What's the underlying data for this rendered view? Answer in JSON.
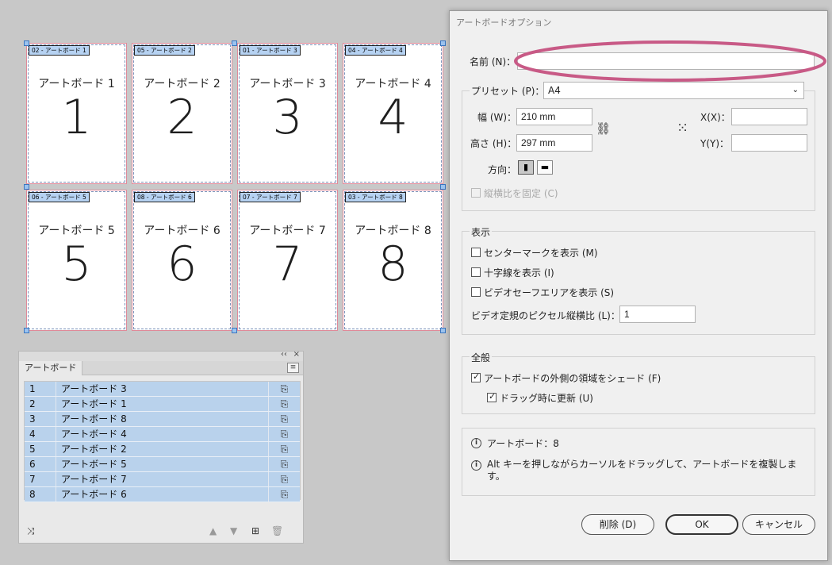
{
  "artboards": [
    {
      "tag": "02 - アートボード 1",
      "name": "アートボード 1",
      "num": "1"
    },
    {
      "tag": "05 - アートボード 2",
      "name": "アートボード 2",
      "num": "2"
    },
    {
      "tag": "01 - アートボード 3",
      "name": "アートボード 3",
      "num": "3"
    },
    {
      "tag": "04 - アートボード 4",
      "name": "アートボード 4",
      "num": "4"
    },
    {
      "tag": "06 - アートボード 5",
      "name": "アートボード 5",
      "num": "5"
    },
    {
      "tag": "08 - アートボード 6",
      "name": "アートボード 6",
      "num": "6"
    },
    {
      "tag": "07 - アートボード 7",
      "name": "アートボード 7",
      "num": "7"
    },
    {
      "tag": "03 - アートボード 8",
      "name": "アートボード 8",
      "num": "8"
    }
  ],
  "panel": {
    "tab": "アートボード",
    "rows": [
      {
        "n": "1",
        "label": "アートボード 3"
      },
      {
        "n": "2",
        "label": "アートボード 1"
      },
      {
        "n": "3",
        "label": "アートボード 8"
      },
      {
        "n": "4",
        "label": "アートボード 4"
      },
      {
        "n": "5",
        "label": "アートボード 2"
      },
      {
        "n": "6",
        "label": "アートボード 5"
      },
      {
        "n": "7",
        "label": "アートボード 7"
      },
      {
        "n": "8",
        "label": "アートボード 6"
      }
    ]
  },
  "dialog": {
    "title": "アートボードオプション",
    "name_label": "名前 (N)：",
    "name_value": "",
    "preset_label": "プリセット (P)：",
    "preset_value": "A4",
    "width_label": "幅 (W)：",
    "width_value": "210 mm",
    "height_label": "高さ (H)：",
    "height_value": "297 mm",
    "x_label": "X(X)：",
    "x_value": "",
    "y_label": "Y(Y)：",
    "y_value": "",
    "orientation_label": "方向：",
    "lock_ratio_label": "縦横比を固定 (C)",
    "display_title": "表示",
    "center_mark_label": "センターマークを表示 (M)",
    "crosshair_label": "十字線を表示 (I)",
    "video_safe_label": "ビデオセーフエリアを表示 (S)",
    "pixel_ratio_label": "ビデオ定規のピクセル縦横比 (L)：",
    "pixel_ratio_value": "1",
    "general_title": "全般",
    "shade_label": "アートボードの外側の領域をシェード (F)",
    "drag_update_label": "ドラッグ時に更新 (U)",
    "info_count": "アートボード：8",
    "info_tip": "Alt キーを押しながらカーソルをドラッグして、アートボードを複製します。",
    "delete_button": "削除 (D)",
    "ok_button": "OK",
    "cancel_button": "キャンセル"
  }
}
